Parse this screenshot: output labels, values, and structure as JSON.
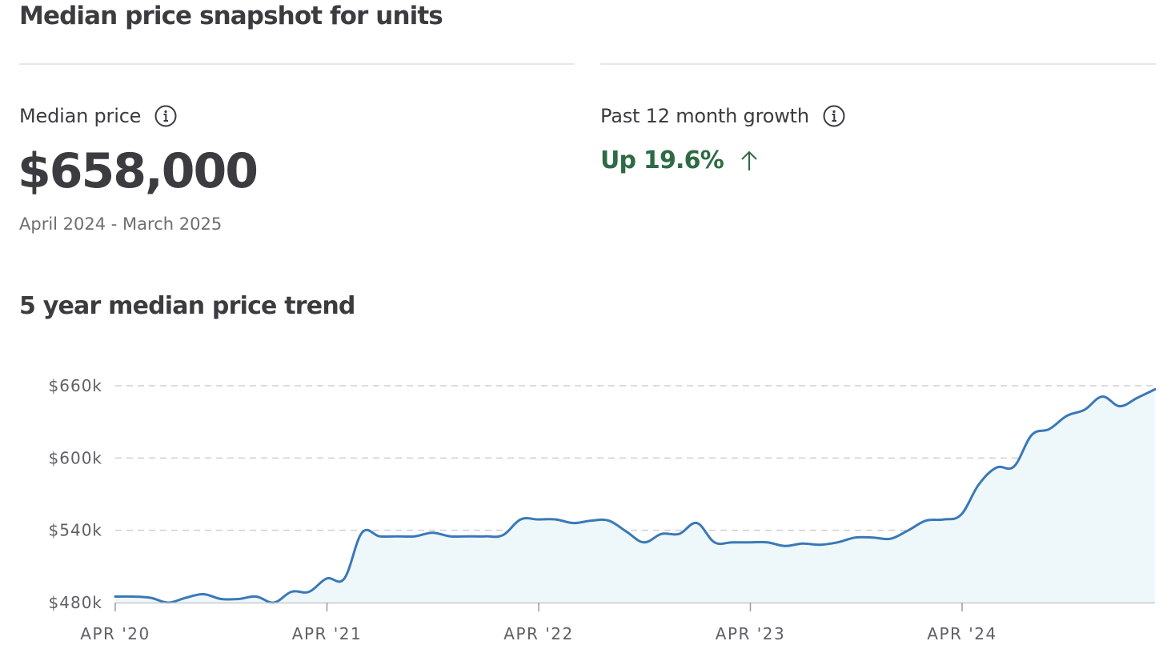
{
  "header": {
    "title": "Median price snapshot for units"
  },
  "median_price": {
    "label": "Median price",
    "value": "$658,000",
    "period": "April 2024 - March 2025"
  },
  "growth": {
    "label": "Past 12 month growth",
    "value": "Up 19.6%",
    "color": "#2e6b45"
  },
  "icons": {
    "info": "info-icon",
    "arrow": "arrow-up-icon"
  },
  "trend": {
    "title": "5 year median price trend"
  },
  "colors": {
    "line": "#3a78b7",
    "fill": "#eef8fb",
    "grid": "#cfcfd4",
    "text": "#3b3b40"
  },
  "chart_data": {
    "type": "area",
    "title": "5 year median price trend",
    "ylim": [
      480000,
      660000
    ],
    "y_ticks": [
      {
        "value": 480000,
        "label": "$480k"
      },
      {
        "value": 540000,
        "label": "$540k"
      },
      {
        "value": 600000,
        "label": "$600k"
      },
      {
        "value": 660000,
        "label": "$660k"
      }
    ],
    "x_ticks": [
      "APR '20",
      "APR '21",
      "APR '22",
      "APR '23",
      "APR '24"
    ],
    "grid": "horizontal dashed",
    "series": [
      {
        "values": [
          485000,
          485000,
          484000,
          480000,
          484000,
          487000,
          483000,
          483000,
          485000,
          480000,
          489000,
          489000,
          500000,
          500000,
          538000,
          535000,
          535000,
          535000,
          538000,
          535000,
          535000,
          535000,
          536000,
          549000,
          549000,
          549000,
          546000,
          548000,
          548000,
          539000,
          530000,
          537000,
          537000,
          546000,
          530000,
          530000,
          530000,
          530000,
          527000,
          529000,
          528000,
          530000,
          534000,
          534000,
          533000,
          540000,
          548000,
          549000,
          553000,
          578000,
          592000,
          593000,
          619000,
          624000,
          635000,
          640000,
          651000,
          643000,
          650000,
          657000
        ]
      }
    ]
  }
}
